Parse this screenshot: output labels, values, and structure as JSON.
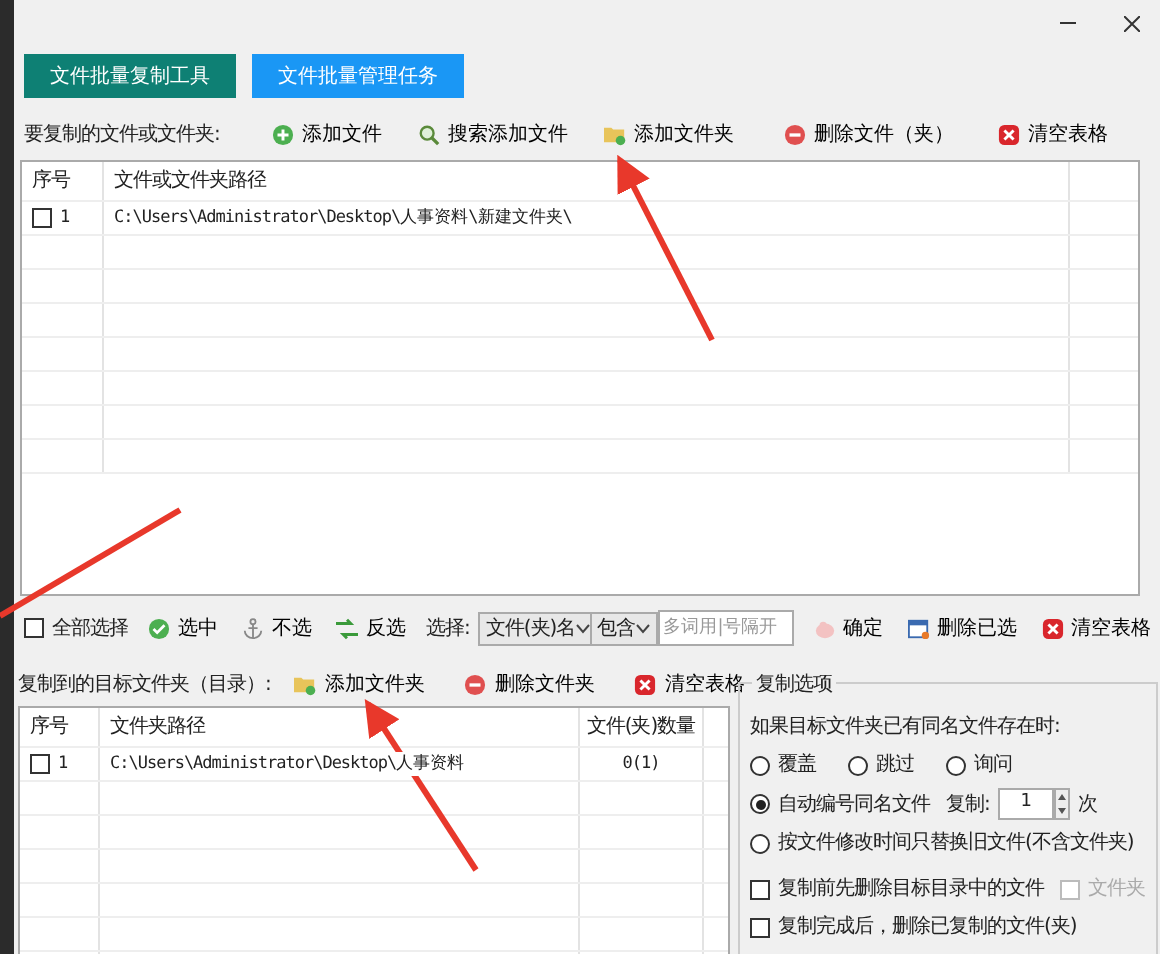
{
  "tool_buttons": [
    {
      "label": "文件批量复制工具",
      "color": "#0e8074"
    },
    {
      "label": "文件批量管理任务",
      "color": "#1a97f5"
    }
  ],
  "source": {
    "label": "要复制的文件或文件夹:",
    "toolbar": [
      {
        "label": "添加文件",
        "kind": "add"
      },
      {
        "label": "搜索添加文件",
        "kind": "search"
      },
      {
        "label": "添加文件夹",
        "kind": "folder"
      },
      {
        "label": "删除文件（夹）",
        "kind": "remove"
      },
      {
        "label": "清空表格",
        "kind": "clear"
      }
    ],
    "columns": [
      "序号",
      "文件或文件夹路径"
    ],
    "rows": [
      {
        "checked": false,
        "index": "1",
        "path": "C:\\Users\\Administrator\\Desktop\\人事资料\\新建文件夹\\"
      }
    ]
  },
  "select_bar": {
    "select_all": {
      "label": "全部选择",
      "checked": false
    },
    "buttons": [
      {
        "label": "选中",
        "kind": "check"
      },
      {
        "label": "不选",
        "kind": "anchor"
      },
      {
        "label": "反选",
        "kind": "invert"
      }
    ],
    "select_label": "选择:",
    "field_dropdown": "文件(夹)名",
    "mode_dropdown": "包含",
    "keyword_placeholder": "多词用|号隔开",
    "actions": [
      {
        "label": "确定",
        "kind": "confirm"
      },
      {
        "label": "删除已选",
        "kind": "window"
      },
      {
        "label": "清空表格",
        "kind": "clear"
      }
    ]
  },
  "target": {
    "label": "复制到的目标文件夹（目录）:",
    "toolbar": [
      {
        "label": "添加文件夹",
        "kind": "folder"
      },
      {
        "label": "删除文件夹",
        "kind": "remove"
      },
      {
        "label": "清空表格",
        "kind": "clear"
      }
    ],
    "columns": [
      "序号",
      "文件夹路径",
      "文件(夹)数量"
    ],
    "rows": [
      {
        "checked": false,
        "index": "1",
        "path": "C:\\Users\\Administrator\\Desktop\\人事资料",
        "count": "0(1)"
      }
    ]
  },
  "options": {
    "title": "复制选项",
    "prompt": "如果目标文件夹已有同名文件存在时:",
    "radios": [
      {
        "label": "覆盖",
        "selected": false
      },
      {
        "label": "跳过",
        "selected": false
      },
      {
        "label": "询问",
        "selected": false
      },
      {
        "label": "自动编号同名文件",
        "selected": true
      },
      {
        "label": "按文件修改时间只替换旧文件(不含文件夹)",
        "selected": false
      }
    ],
    "copies_label": "复制:",
    "copies_value": "1",
    "copies_unit": "次",
    "checkboxes": [
      {
        "label": "复制前先删除目标目录中的文件",
        "checked": false,
        "disabled": false
      },
      {
        "label": "文件夹",
        "checked": false,
        "disabled": true
      },
      {
        "label": "复制完成后，删除已复制的文件(夹)",
        "checked": false,
        "disabled": false
      }
    ]
  }
}
